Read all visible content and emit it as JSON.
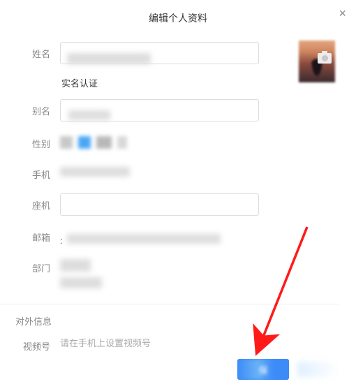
{
  "title": "编辑个人资料",
  "close": "×",
  "labels": {
    "name": "姓名",
    "realname_auth": "实名认证",
    "alias": "别名",
    "gender": "性别",
    "mobile": "手机",
    "landline": "座机",
    "email": "邮箱",
    "department": "部门"
  },
  "external_section": "对外信息",
  "video_label": "视频号",
  "video_placeholder": "请在手机上设置视频号",
  "submit_label": "保"
}
